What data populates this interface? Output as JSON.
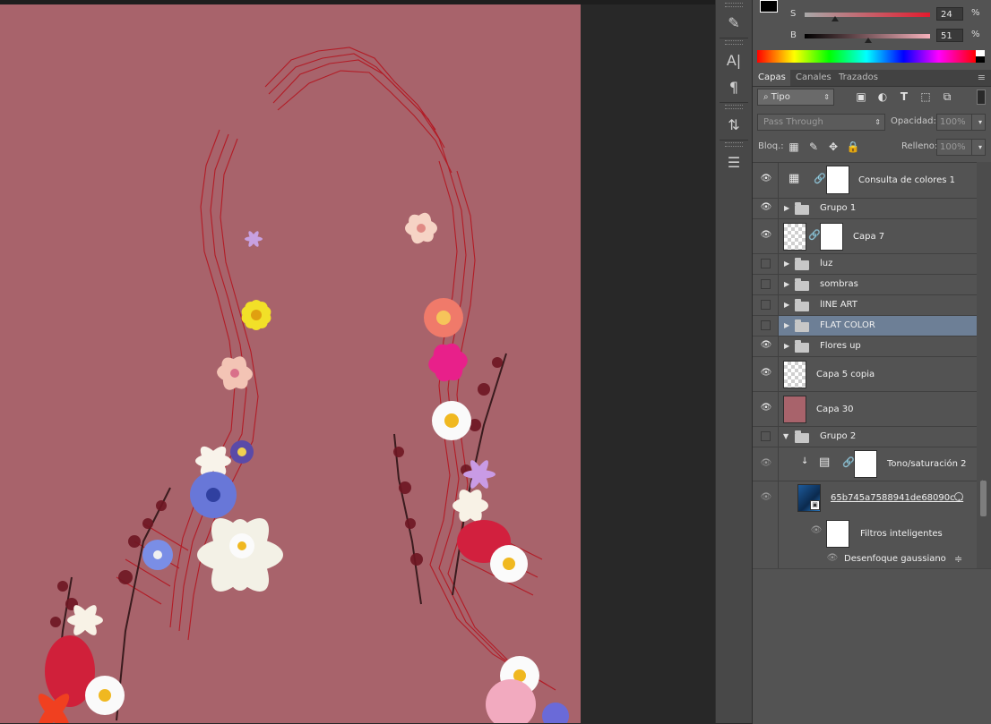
{
  "color_panel": {
    "s_label": "S",
    "s_value": "24",
    "s_unit": "%",
    "b_label": "B",
    "b_value": "51",
    "b_unit": "%",
    "s_level": 0.24,
    "b_level": 0.51
  },
  "tabs": [
    {
      "label": "Capas",
      "active": true
    },
    {
      "label": "Canales",
      "active": false
    },
    {
      "label": "Trazados",
      "active": false
    }
  ],
  "filter": {
    "kind_label": "Tipo",
    "icons": [
      "image-filter-icon",
      "adjustment-filter-icon",
      "type-filter-icon",
      "shape-filter-icon",
      "smart-object-filter-icon"
    ]
  },
  "blend": {
    "mode": "Pass Through",
    "opacity_label": "Opacidad:",
    "opacity_value": "100%"
  },
  "lock": {
    "label": "Bloq.:",
    "fill_label": "Relleno:",
    "fill_value": "100%"
  },
  "layers": [
    {
      "name": "Consulta de colores 1",
      "visible": true,
      "kind": "adjustment"
    },
    {
      "name": "Grupo 1",
      "visible": true,
      "kind": "group"
    },
    {
      "name": "Capa 7",
      "visible": true,
      "kind": "masked"
    },
    {
      "name": "luz",
      "visible": false,
      "kind": "group"
    },
    {
      "name": "sombras",
      "visible": false,
      "kind": "group"
    },
    {
      "name": "lINE ART",
      "visible": false,
      "kind": "group"
    },
    {
      "name": "FLAT COLOR",
      "visible": false,
      "kind": "group",
      "selected": true
    },
    {
      "name": "Flores up",
      "visible": true,
      "kind": "group"
    },
    {
      "name": "Capa 5 copia",
      "visible": true,
      "kind": "pixel"
    },
    {
      "name": "Capa 30",
      "visible": true,
      "kind": "fill"
    },
    {
      "name": "Grupo 2",
      "visible": false,
      "kind": "group-open"
    },
    {
      "name": "Tono/saturación 2",
      "visible": true,
      "kind": "adjustment-clipped"
    },
    {
      "name": "65b745a7588941de68090c...",
      "visible": true,
      "kind": "smart-object"
    },
    {
      "name": "Filtros inteligentes",
      "visible": true,
      "kind": "smart-filter"
    },
    {
      "name": "Desenfoque gaussiano",
      "visible": true,
      "kind": "filter"
    }
  ],
  "colors": {
    "canvas": "#a8636b",
    "selected_row": "#6d7f96",
    "panel_bg": "#535353"
  }
}
